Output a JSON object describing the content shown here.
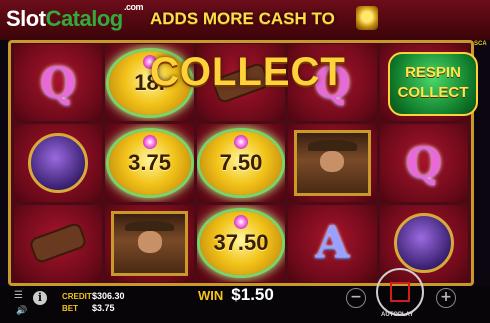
{
  "watermark": {
    "part1": "Slot",
    "part2": "Catalog",
    "part3": ".com"
  },
  "banner": {
    "text": "ADDS MORE CASH TO"
  },
  "feature": {
    "collect_title": "COLLECT",
    "respin_line1": "RESPIN",
    "respin_line2": "COLLECT"
  },
  "side_tag": "SCA",
  "reels": [
    [
      {
        "type": "Q"
      },
      {
        "type": "anubis"
      },
      {
        "type": "gun"
      }
    ],
    [
      {
        "type": "coin",
        "value": "18."
      },
      {
        "type": "coin",
        "value": "3.75"
      },
      {
        "type": "explorer"
      }
    ],
    [
      {
        "type": "gun"
      },
      {
        "type": "coin",
        "value": "7.50"
      },
      {
        "type": "coin",
        "value": "37.50"
      }
    ],
    [
      {
        "type": "Q"
      },
      {
        "type": "explorer"
      },
      {
        "type": "A"
      }
    ],
    [
      {
        "type": "respin"
      },
      {
        "type": "Q"
      },
      {
        "type": "anubis"
      }
    ]
  ],
  "footer": {
    "credit_label": "CREDIT",
    "credit_value": "$306.30",
    "bet_label": "BET",
    "bet_value": "$3.75",
    "win_label": "WIN",
    "win_value": "$1.50",
    "autoplay_label": "AUTOPLAY",
    "info_glyph": "i",
    "menu_glyph": "☰",
    "sound_glyph": "🔊",
    "minus_glyph": "−",
    "plus_glyph": "+"
  },
  "colors": {
    "gold": "#f2c41a",
    "reel_red": "#6d0a1a",
    "respin_green": "#0f7a2a",
    "stop_red": "#d01e1e"
  }
}
